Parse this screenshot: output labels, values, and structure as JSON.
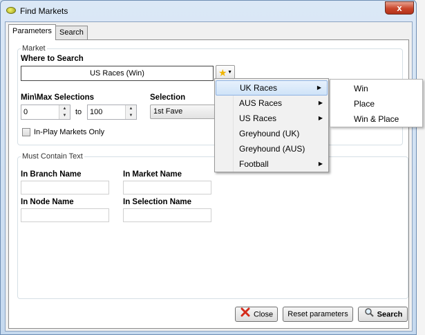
{
  "window": {
    "title": "Find Markets",
    "close_glyph": "x"
  },
  "tabs": [
    {
      "label": "Parameters",
      "active": true
    },
    {
      "label": "Search",
      "active": false
    }
  ],
  "market": {
    "legend": "Market",
    "where_label": "Where to Search",
    "where_value": "US Races (Win)",
    "minmax_label": "Min\\Max Selections",
    "min_value": "0",
    "to_label": "to",
    "max_value": "100",
    "selection_label": "Selection",
    "selection_value": "1st Fave",
    "inplay_label": "In-Play Markets Only",
    "inplay_checked": false
  },
  "must_contain": {
    "legend": "Must Contain Text",
    "branch_label": "In Branch Name",
    "market_label": "In Market Name",
    "node_label": "In Node Name",
    "selection_label": "In Selection Name",
    "branch_value": "",
    "market_value": "",
    "node_value": "",
    "selection_value": ""
  },
  "buttons": {
    "close": "Close",
    "reset": "Reset parameters",
    "search": "Search"
  },
  "menu": {
    "items": [
      {
        "label": "UK Races",
        "has_submenu": true,
        "highlighted": true
      },
      {
        "label": "AUS Races",
        "has_submenu": true
      },
      {
        "label": "US Races",
        "has_submenu": true
      },
      {
        "label": "Greyhound (UK)",
        "has_submenu": false
      },
      {
        "label": "Greyhound (AUS)",
        "has_submenu": false
      },
      {
        "label": "Football",
        "has_submenu": true
      }
    ],
    "submenu": [
      {
        "label": "Win"
      },
      {
        "label": "Place"
      },
      {
        "label": "Win & Place"
      }
    ]
  },
  "icons": {
    "app": "app-icon",
    "favorite": "star-icon",
    "close": "red-x-icon",
    "search": "magnifier-icon"
  },
  "colors": {
    "highlight_border": "#8db2e3",
    "title_close": "#c9462b",
    "star": "#f0b400",
    "x_red": "#d42a1a"
  }
}
